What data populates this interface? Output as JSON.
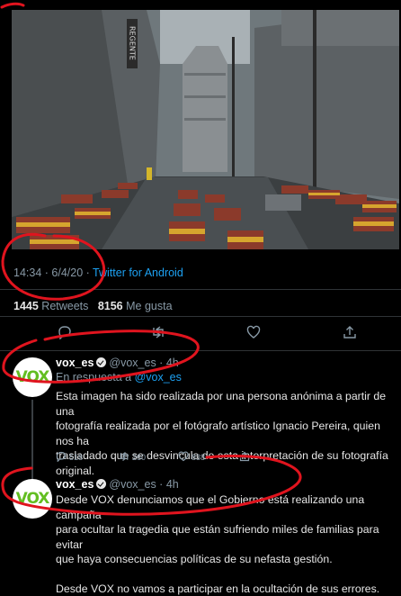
{
  "main_tweet": {
    "time": "14:34",
    "date": "6/4/20",
    "via_label": "Twitter for Android",
    "retweets_count": "1445",
    "retweets_label": "Retweets",
    "likes_count": "8156",
    "likes_label": "Me gusta"
  },
  "replies": [
    {
      "avatar_text": "VOX",
      "name": "vox_es",
      "handle": "@vox_es",
      "time": "4h",
      "reply_prefix": "En respuesta a",
      "reply_to": "@vox_es",
      "lines": [
        "Esta imagen ha sido realizada por una persona anónima a partir de una",
        "fotografía realizada por el fotógrafo artístico Ignacio Pereira, quien nos ha",
        "trasladado que se desvincula de esta interpretación de su fotografía",
        "original."
      ],
      "reply_count": "518",
      "retweet_count": "260",
      "like_count": "838"
    },
    {
      "avatar_text": "VOX",
      "name": "vox_es",
      "handle": "@vox_es",
      "time": "4h",
      "lines": [
        "Desde VOX denunciamos que el Gobierno está realizando una campaña",
        "para ocultar la tragedia que están sufriendo miles de familias para evitar",
        "que haya consecuencias políticas de su nefasta gestión."
      ],
      "lines2": [
        "Desde VOX no vamos a participar en la ocultación de sus errores."
      ]
    }
  ],
  "photo_sign": "REGENTE",
  "colors": {
    "link": "#1da1f2",
    "muted": "#8899a6",
    "annotation": "#e0141e",
    "vox_green": "#63be21"
  }
}
